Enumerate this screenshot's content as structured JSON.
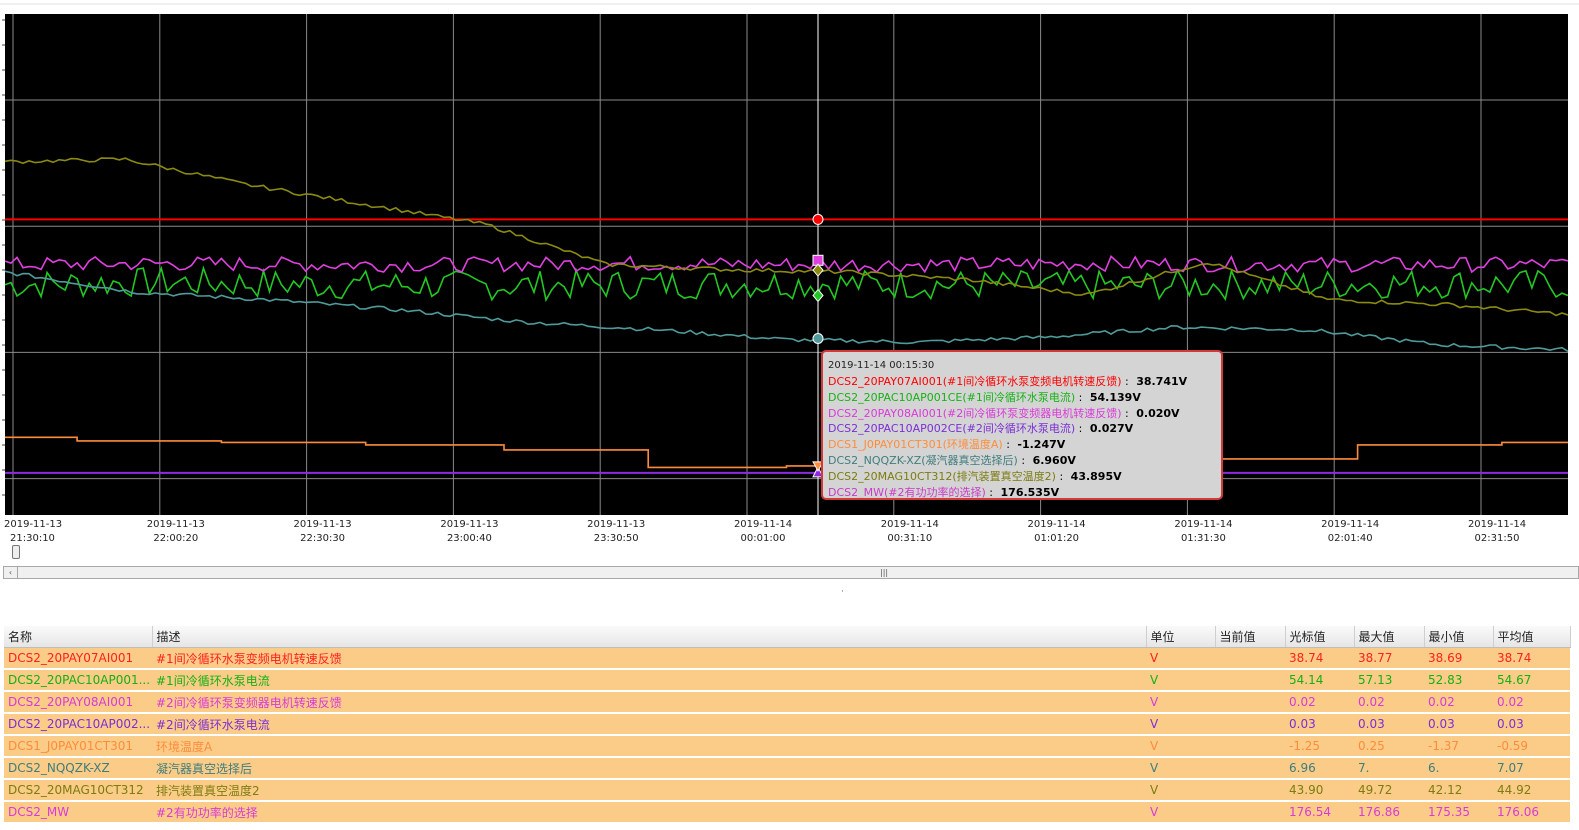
{
  "chart_data": {
    "type": "line",
    "title": "",
    "xlabel": "",
    "ylabel": "",
    "x_ticks": [
      {
        "date": "2019-11-13",
        "time": "21:30:10"
      },
      {
        "date": "2019-11-13",
        "time": "22:00:20"
      },
      {
        "date": "2019-11-13",
        "time": "22:30:30"
      },
      {
        "date": "2019-11-13",
        "time": "23:00:40"
      },
      {
        "date": "2019-11-13",
        "time": "23:30:50"
      },
      {
        "date": "2019-11-14",
        "time": "00:01:00"
      },
      {
        "date": "2019-11-14",
        "time": "00:31:10"
      },
      {
        "date": "2019-11-14",
        "time": "01:01:20"
      },
      {
        "date": "2019-11-14",
        "time": "01:31:30"
      },
      {
        "date": "2019-11-14",
        "time": "02:01:40"
      },
      {
        "date": "2019-11-14",
        "time": "02:31:50"
      }
    ],
    "x_range": [
      "2019-11-13 21:30:10",
      "2019-11-14 02:47:40"
    ],
    "grid": true,
    "background": "#000000",
    "grid_color": "#8a8a8a",
    "cursor_time": "2019-11-14 00:15:30",
    "series": [
      {
        "tag": "DCS2_20PAY07AI001",
        "color": "#ff0000",
        "pattern": "flat",
        "y_norm": [
          0.59,
          0.59,
          0.59,
          0.59,
          0.59,
          0.59,
          0.59,
          0.59,
          0.59,
          0.59,
          0.59
        ],
        "noise": 0.0,
        "cursor_value": "38.741V",
        "marker": "circle"
      },
      {
        "tag": "DCS2_20PAC10AP001CE",
        "color": "#22c822",
        "pattern": "noisy",
        "y_norm": [
          0.46,
          0.465,
          0.46,
          0.458,
          0.46,
          0.462,
          0.46,
          0.458,
          0.46,
          0.462,
          0.46
        ],
        "noise": 0.03,
        "cursor_value": "54.139V",
        "marker": "diamond"
      },
      {
        "tag": "DCS2_20PAY08AI001",
        "color": "#e040e0",
        "pattern": "noisy",
        "y_norm": [
          0.5,
          0.502,
          0.5,
          0.5,
          0.502,
          0.5,
          0.5,
          0.502,
          0.5,
          0.5,
          0.5
        ],
        "noise": 0.015,
        "cursor_value": "0.020V",
        "marker": "square"
      },
      {
        "tag": "DCS2_20PAC10AP002CE",
        "color": "#8e2be2",
        "pattern": "flat",
        "y_norm": [
          0.084,
          0.084,
          0.084,
          0.084,
          0.084,
          0.084,
          0.084,
          0.084,
          0.084,
          0.084,
          0.084
        ],
        "noise": 0.0,
        "cursor_value": "0.027V",
        "marker": "triangle"
      },
      {
        "tag": "DCS1_J0PAY01CT301",
        "color": "#ff8c3a",
        "pattern": "step",
        "y_norm": [
          0.155,
          0.148,
          0.145,
          0.14,
          0.13,
          0.095,
          0.098,
          0.11,
          0.105,
          0.112,
          0.14,
          0.145
        ],
        "noise": 0.0,
        "cursor_value": "-1.247V",
        "marker": "triangle-down"
      },
      {
        "tag": "DCS2_NQQZK-XZ",
        "color": "#4f9a9a",
        "pattern": "smooth",
        "y_norm": [
          0.485,
          0.445,
          0.43,
          0.41,
          0.385,
          0.37,
          0.35,
          0.345,
          0.355,
          0.375,
          0.37,
          0.34,
          0.33
        ],
        "noise": 0.0,
        "cursor_value": "6.960V",
        "marker": "circle"
      },
      {
        "tag": "DCS2_20MAG10CT312",
        "color": "#8b8b10",
        "pattern": "smooth",
        "y_norm": [
          0.705,
          0.71,
          0.66,
          0.62,
          0.58,
          0.5,
          0.49,
          0.485,
          0.47,
          0.44,
          0.505,
          0.43,
          0.42,
          0.4
        ],
        "noise": 0.0,
        "cursor_value": "43.895V",
        "marker": "diamond"
      },
      {
        "tag": "DCS2_MW",
        "color": "#e040e0",
        "pattern": "flat",
        "y_norm": [],
        "noise": 0.0,
        "cursor_value": "176.535V",
        "marker": "none"
      }
    ]
  },
  "tooltip": {
    "time": "2019-11-14 00:15:30",
    "rows": [
      {
        "name": "DCS2_20PAY07AI001",
        "desc": "(#1间冷循环水泵变频电机转速反馈)",
        "value": "38.741V",
        "color": "#ff0000"
      },
      {
        "name": "DCS2_20PAC10AP001CE",
        "desc": "(#1间冷循环水泵电流)",
        "value": "54.139V",
        "color": "#16b316"
      },
      {
        "name": "DCS2_20PAY08AI001",
        "desc": "(#2间冷循环泵变频器电机转速反馈)",
        "value": "0.020V",
        "color": "#d93ad9"
      },
      {
        "name": "DCS2_20PAC10AP002CE",
        "desc": "(#2间冷循环水泵电流)",
        "value": "0.027V",
        "color": "#7b2fd6"
      },
      {
        "name": "DCS1_J0PAY01CT301",
        "desc": "(环境温度A)",
        "value": "-1.247V",
        "color": "#ff8c3a"
      },
      {
        "name": "DCS2_NQQZK-XZ",
        "desc": "(凝汽器真空选择后)",
        "value": "6.960V",
        "color": "#3f7d7d"
      },
      {
        "name": "DCS2_20MAG10CT312",
        "desc": "(排汽装置真空温度2)",
        "value": "43.895V",
        "color": "#7c7c10"
      },
      {
        "name": "DCS2_MW",
        "desc": "(#2有功功率的选择)",
        "value": "176.535V",
        "color": "#c83cc8"
      }
    ]
  },
  "table": {
    "headers": [
      "名称",
      "描述",
      "单位",
      "当前值",
      "光标值",
      "最大值",
      "最小值",
      "平均值"
    ],
    "rows": [
      {
        "color": "#ff2020",
        "cells": [
          "DCS2_20PAY07AI001",
          "#1间冷循环水泵变频电机转速反馈",
          "V",
          "",
          "38.74",
          "38.77",
          "38.69",
          "38.74"
        ]
      },
      {
        "color": "#15b015",
        "cells": [
          "DCS2_20PAC10AP001...",
          "#1间冷循环水泵电流",
          "V",
          "",
          "54.14",
          "57.13",
          "52.83",
          "54.67"
        ]
      },
      {
        "color": "#d93ad9",
        "cells": [
          "DCS2_20PAY08AI001",
          "#2间冷循环泵变频器电机转速反馈",
          "V",
          "",
          "0.02",
          "0.02",
          "0.02",
          "0.02"
        ]
      },
      {
        "color": "#7b2fd6",
        "cells": [
          "DCS2_20PAC10AP002...",
          "#2间冷循环水泵电流",
          "V",
          "",
          "0.03",
          "0.03",
          "0.03",
          "0.03"
        ]
      },
      {
        "color": "#ff8c3a",
        "cells": [
          "DCS1_J0PAY01CT301",
          "环境温度A",
          "V",
          "",
          "-1.25",
          "0.25",
          "-1.37",
          "-0.59"
        ]
      },
      {
        "color": "#3f7d7d",
        "cells": [
          "DCS2_NQQZK-XZ",
          "凝汽器真空选择后",
          "V",
          "",
          "6.96",
          "7.",
          "6.",
          "7.07"
        ]
      },
      {
        "color": "#7c7c10",
        "cells": [
          "DCS2_20MAG10CT312",
          "排汽装置真空温度2",
          "V",
          "",
          "43.90",
          "49.72",
          "42.12",
          "44.92"
        ]
      },
      {
        "color": "#d93ad9",
        "cells": [
          "DCS2_MW",
          "#2有功功率的选择",
          "V",
          "",
          "176.54",
          "176.86",
          "175.35",
          "176.06"
        ]
      }
    ]
  },
  "scrollbar": {
    "left_arrow": "‹",
    "grip": "|||"
  },
  "splitter": {
    "dots": "·"
  }
}
